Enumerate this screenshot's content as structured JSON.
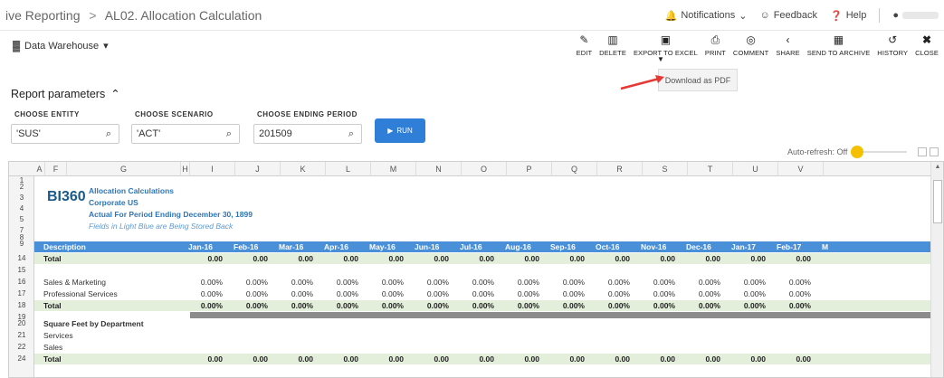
{
  "breadcrumb": {
    "parent": "ive Reporting",
    "separator": ">",
    "current": "AL02. Allocation Calculation"
  },
  "topbar": {
    "notifications": "Notifications",
    "feedback": "Feedback",
    "help": "Help"
  },
  "workspace": {
    "label": "Data Warehouse"
  },
  "toolbar": {
    "items": [
      {
        "label": "EDIT",
        "icon": "pencil-icon"
      },
      {
        "label": "DELETE",
        "icon": "trash-icon"
      },
      {
        "label": "EXPORT TO EXCEL",
        "icon": "excel-icon"
      },
      {
        "label": "PRINT",
        "icon": "printer-icon"
      },
      {
        "label": "COMMENT",
        "icon": "comment-icon"
      },
      {
        "label": "SHARE",
        "icon": "share-icon"
      },
      {
        "label": "SEND TO ARCHIVE",
        "icon": "archive-icon"
      },
      {
        "label": "HISTORY",
        "icon": "history-icon"
      },
      {
        "label": "CLOSE",
        "icon": "close-icon"
      }
    ],
    "dropdown_item": "Download as PDF",
    "accent": "#e53935"
  },
  "params": {
    "title": "Report parameters",
    "entity": {
      "label": "CHOOSE ENTITY",
      "value": "'SUS'"
    },
    "scenario": {
      "label": "CHOOSE SCENARIO",
      "value": "'ACT'"
    },
    "period": {
      "label": "CHOOSE ENDING PERIOD",
      "value": "201509"
    },
    "run_label": "RUN",
    "run_color": "#2f7fd8"
  },
  "autorefresh": {
    "label": "Auto-refresh: Off"
  },
  "sheet": {
    "columns": [
      "A",
      "F",
      "G",
      "H",
      "I",
      "J",
      "K",
      "L",
      "M",
      "N",
      "O",
      "P",
      "Q",
      "R",
      "S",
      "T",
      "U",
      "V"
    ],
    "header_lines": {
      "logo": "BI360",
      "title": "Allocation Calculations",
      "entity": "Corporate US",
      "period": "Actual For Period Ending December 30, 1899",
      "note": "Fields in Light Blue are Being Stored Back"
    },
    "months": [
      "Jan-16",
      "Feb-16",
      "Mar-16",
      "Apr-16",
      "May-16",
      "Jun-16",
      "Jul-16",
      "Aug-16",
      "Sep-16",
      "Oct-16",
      "Nov-16",
      "Dec-16",
      "Jan-17",
      "Feb-17",
      "M"
    ],
    "description_header": "Description",
    "rows": [
      {
        "num": "14",
        "desc": "Total",
        "type": "total",
        "values": [
          "0.00",
          "0.00",
          "0.00",
          "0.00",
          "0.00",
          "0.00",
          "0.00",
          "0.00",
          "0.00",
          "0.00",
          "0.00",
          "0.00",
          "0.00",
          "0.00"
        ]
      },
      {
        "num": "15",
        "desc": "",
        "type": "blank",
        "values": []
      },
      {
        "num": "16",
        "desc": "Sales & Marketing",
        "type": "data",
        "values": [
          "0.00%",
          "0.00%",
          "0.00%",
          "0.00%",
          "0.00%",
          "0.00%",
          "0.00%",
          "0.00%",
          "0.00%",
          "0.00%",
          "0.00%",
          "0.00%",
          "0.00%",
          "0.00%"
        ]
      },
      {
        "num": "17",
        "desc": "Professional Services",
        "type": "data",
        "values": [
          "0.00%",
          "0.00%",
          "0.00%",
          "0.00%",
          "0.00%",
          "0.00%",
          "0.00%",
          "0.00%",
          "0.00%",
          "0.00%",
          "0.00%",
          "0.00%",
          "0.00%",
          "0.00%"
        ]
      },
      {
        "num": "18",
        "desc": "Total",
        "type": "total",
        "values": [
          "0.00%",
          "0.00%",
          "0.00%",
          "0.00%",
          "0.00%",
          "0.00%",
          "0.00%",
          "0.00%",
          "0.00%",
          "0.00%",
          "0.00%",
          "0.00%",
          "0.00%",
          "0.00%"
        ]
      },
      {
        "num": "19",
        "desc": "",
        "type": "gray",
        "values": []
      },
      {
        "num": "20",
        "desc": "Square Feet by Department",
        "type": "section",
        "values": []
      },
      {
        "num": "21",
        "desc": "Services",
        "type": "data",
        "values": []
      },
      {
        "num": "22",
        "desc": "Sales",
        "type": "data",
        "values": []
      },
      {
        "num": "24",
        "desc": "Total",
        "type": "total",
        "values": [
          "0.00",
          "0.00",
          "0.00",
          "0.00",
          "0.00",
          "0.00",
          "0.00",
          "0.00",
          "0.00",
          "0.00",
          "0.00",
          "0.00",
          "0.00",
          "0.00"
        ]
      }
    ],
    "header_row_nums": [
      "1",
      "2",
      "3",
      "4",
      "5",
      "7",
      "8",
      "9"
    ],
    "colors": {
      "header_blue": "#4a90d9",
      "total_green": "#e3eedb",
      "title_blue": "#2e75b6"
    }
  }
}
